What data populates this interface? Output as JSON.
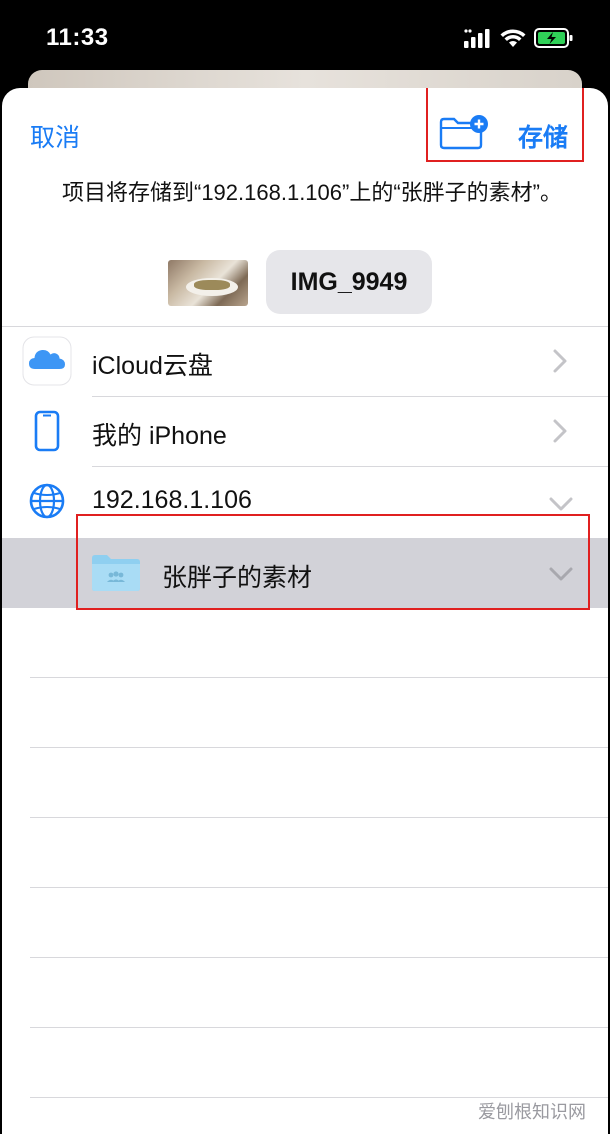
{
  "status_bar": {
    "time": "11:33"
  },
  "nav": {
    "cancel_label": "取消",
    "save_label": "存储"
  },
  "save_message": "项目将存储到“192.168.1.106”上的“张胖子的素材”。",
  "file": {
    "name": "IMG_9949"
  },
  "locations": [
    {
      "label": "iCloud云盘",
      "icon": "icloud-icon",
      "expanded": false
    },
    {
      "label": "我的 iPhone",
      "icon": "iphone-icon",
      "expanded": false
    },
    {
      "label": "192.168.1.106",
      "icon": "globe-icon",
      "expanded": true
    }
  ],
  "selected_folder": {
    "label": "张胖子的素材",
    "icon": "shared-folder-icon"
  },
  "watermark": "爱刨根知识网",
  "colors": {
    "accent": "#1a7cf5",
    "highlight_box": "#e02020",
    "selected_row": "#d2d2d8"
  }
}
